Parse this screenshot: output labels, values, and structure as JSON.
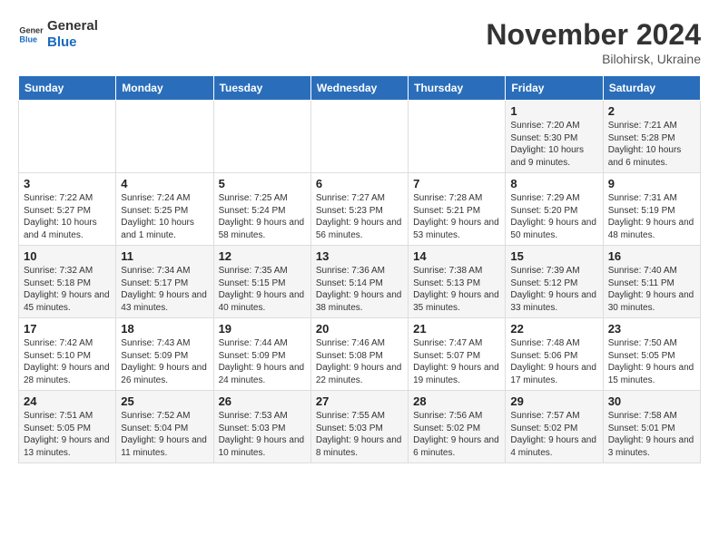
{
  "header": {
    "logo_general": "General",
    "logo_blue": "Blue",
    "month": "November 2024",
    "location": "Bilohirsk, Ukraine"
  },
  "weekdays": [
    "Sunday",
    "Monday",
    "Tuesday",
    "Wednesday",
    "Thursday",
    "Friday",
    "Saturday"
  ],
  "weeks": [
    [
      {
        "day": "",
        "info": ""
      },
      {
        "day": "",
        "info": ""
      },
      {
        "day": "",
        "info": ""
      },
      {
        "day": "",
        "info": ""
      },
      {
        "day": "",
        "info": ""
      },
      {
        "day": "1",
        "info": "Sunrise: 7:20 AM\nSunset: 5:30 PM\nDaylight: 10 hours and 9 minutes."
      },
      {
        "day": "2",
        "info": "Sunrise: 7:21 AM\nSunset: 5:28 PM\nDaylight: 10 hours and 6 minutes."
      }
    ],
    [
      {
        "day": "3",
        "info": "Sunrise: 7:22 AM\nSunset: 5:27 PM\nDaylight: 10 hours and 4 minutes."
      },
      {
        "day": "4",
        "info": "Sunrise: 7:24 AM\nSunset: 5:25 PM\nDaylight: 10 hours and 1 minute."
      },
      {
        "day": "5",
        "info": "Sunrise: 7:25 AM\nSunset: 5:24 PM\nDaylight: 9 hours and 58 minutes."
      },
      {
        "day": "6",
        "info": "Sunrise: 7:27 AM\nSunset: 5:23 PM\nDaylight: 9 hours and 56 minutes."
      },
      {
        "day": "7",
        "info": "Sunrise: 7:28 AM\nSunset: 5:21 PM\nDaylight: 9 hours and 53 minutes."
      },
      {
        "day": "8",
        "info": "Sunrise: 7:29 AM\nSunset: 5:20 PM\nDaylight: 9 hours and 50 minutes."
      },
      {
        "day": "9",
        "info": "Sunrise: 7:31 AM\nSunset: 5:19 PM\nDaylight: 9 hours and 48 minutes."
      }
    ],
    [
      {
        "day": "10",
        "info": "Sunrise: 7:32 AM\nSunset: 5:18 PM\nDaylight: 9 hours and 45 minutes."
      },
      {
        "day": "11",
        "info": "Sunrise: 7:34 AM\nSunset: 5:17 PM\nDaylight: 9 hours and 43 minutes."
      },
      {
        "day": "12",
        "info": "Sunrise: 7:35 AM\nSunset: 5:15 PM\nDaylight: 9 hours and 40 minutes."
      },
      {
        "day": "13",
        "info": "Sunrise: 7:36 AM\nSunset: 5:14 PM\nDaylight: 9 hours and 38 minutes."
      },
      {
        "day": "14",
        "info": "Sunrise: 7:38 AM\nSunset: 5:13 PM\nDaylight: 9 hours and 35 minutes."
      },
      {
        "day": "15",
        "info": "Sunrise: 7:39 AM\nSunset: 5:12 PM\nDaylight: 9 hours and 33 minutes."
      },
      {
        "day": "16",
        "info": "Sunrise: 7:40 AM\nSunset: 5:11 PM\nDaylight: 9 hours and 30 minutes."
      }
    ],
    [
      {
        "day": "17",
        "info": "Sunrise: 7:42 AM\nSunset: 5:10 PM\nDaylight: 9 hours and 28 minutes."
      },
      {
        "day": "18",
        "info": "Sunrise: 7:43 AM\nSunset: 5:09 PM\nDaylight: 9 hours and 26 minutes."
      },
      {
        "day": "19",
        "info": "Sunrise: 7:44 AM\nSunset: 5:09 PM\nDaylight: 9 hours and 24 minutes."
      },
      {
        "day": "20",
        "info": "Sunrise: 7:46 AM\nSunset: 5:08 PM\nDaylight: 9 hours and 22 minutes."
      },
      {
        "day": "21",
        "info": "Sunrise: 7:47 AM\nSunset: 5:07 PM\nDaylight: 9 hours and 19 minutes."
      },
      {
        "day": "22",
        "info": "Sunrise: 7:48 AM\nSunset: 5:06 PM\nDaylight: 9 hours and 17 minutes."
      },
      {
        "day": "23",
        "info": "Sunrise: 7:50 AM\nSunset: 5:05 PM\nDaylight: 9 hours and 15 minutes."
      }
    ],
    [
      {
        "day": "24",
        "info": "Sunrise: 7:51 AM\nSunset: 5:05 PM\nDaylight: 9 hours and 13 minutes."
      },
      {
        "day": "25",
        "info": "Sunrise: 7:52 AM\nSunset: 5:04 PM\nDaylight: 9 hours and 11 minutes."
      },
      {
        "day": "26",
        "info": "Sunrise: 7:53 AM\nSunset: 5:03 PM\nDaylight: 9 hours and 10 minutes."
      },
      {
        "day": "27",
        "info": "Sunrise: 7:55 AM\nSunset: 5:03 PM\nDaylight: 9 hours and 8 minutes."
      },
      {
        "day": "28",
        "info": "Sunrise: 7:56 AM\nSunset: 5:02 PM\nDaylight: 9 hours and 6 minutes."
      },
      {
        "day": "29",
        "info": "Sunrise: 7:57 AM\nSunset: 5:02 PM\nDaylight: 9 hours and 4 minutes."
      },
      {
        "day": "30",
        "info": "Sunrise: 7:58 AM\nSunset: 5:01 PM\nDaylight: 9 hours and 3 minutes."
      }
    ]
  ]
}
